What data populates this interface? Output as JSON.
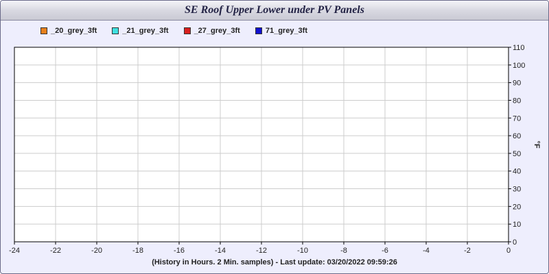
{
  "chart_data": {
    "type": "line",
    "title": "SE Roof Upper Lower under PV Panels",
    "xlabel": "(History in Hours. 2 Min. samples) - Last update: 03/20/2022 09:59:26",
    "ylabel": "°F",
    "xlim": [
      -24,
      0
    ],
    "ylim": [
      0,
      110
    ],
    "x_ticks": [
      -24,
      -22,
      -20,
      -18,
      -16,
      -14,
      -12,
      -10,
      -8,
      -6,
      -4,
      -2,
      0
    ],
    "y_ticks": [
      0,
      10,
      20,
      30,
      40,
      50,
      60,
      70,
      80,
      90,
      100,
      110
    ],
    "grid": true,
    "legend_position": "top-left",
    "series": [
      {
        "name": "_20_grey_3ft",
        "color": "#e8801c",
        "values": []
      },
      {
        "name": "_21_grey_3ft",
        "color": "#3fe0e0",
        "values": []
      },
      {
        "name": "_27_grey_3ft",
        "color": "#d92020",
        "values": []
      },
      {
        "name": "71_grey_3ft",
        "color": "#1010d0",
        "values": []
      }
    ]
  }
}
